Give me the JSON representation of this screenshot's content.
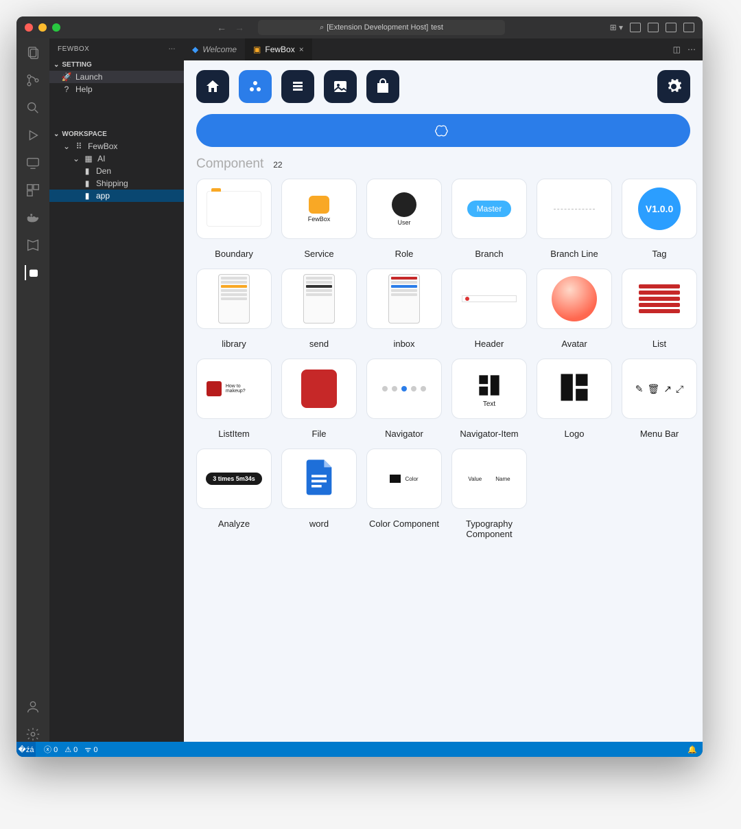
{
  "titlebar": {
    "search_prefix": "[Extension Development Host]",
    "search_text": "test"
  },
  "sidebar": {
    "title": "FEWBOX",
    "sections": {
      "setting": {
        "label": "SETTING",
        "items": [
          {
            "label": "Launch"
          },
          {
            "label": "Help"
          }
        ]
      },
      "workspace": {
        "label": "WORKSPACE",
        "tree": {
          "root": "FewBox",
          "ai": "AI",
          "children": [
            {
              "label": "Den"
            },
            {
              "label": "Shipping"
            },
            {
              "label": "app"
            }
          ]
        }
      }
    }
  },
  "tabs": [
    {
      "label": "Welcome",
      "active": false
    },
    {
      "label": "FewBox",
      "active": true
    }
  ],
  "fewbox": {
    "section_title": "Component",
    "count": "22",
    "master_label": "Master",
    "tag_label": "V1.0.0",
    "analyze_label": "3 times 5m34s",
    "navitem_text": "Text",
    "service_label": "FewBox",
    "role_label": "User",
    "listitem_text": "How to makeup?",
    "color_text": "Color",
    "typo_value": "Value",
    "typo_name": "Name",
    "components": [
      "Boundary",
      "Service",
      "Role",
      "Branch",
      "Branch Line",
      "Tag",
      "library",
      "send",
      "inbox",
      "Header",
      "Avatar",
      "List",
      "ListItem",
      "File",
      "Navigator",
      "Navigator-Item",
      "Logo",
      "Menu Bar",
      "Analyze",
      "word",
      "Color Component",
      "Typography Component"
    ]
  },
  "statusbar": {
    "errors": "0",
    "warnings": "0",
    "ports": "0"
  }
}
